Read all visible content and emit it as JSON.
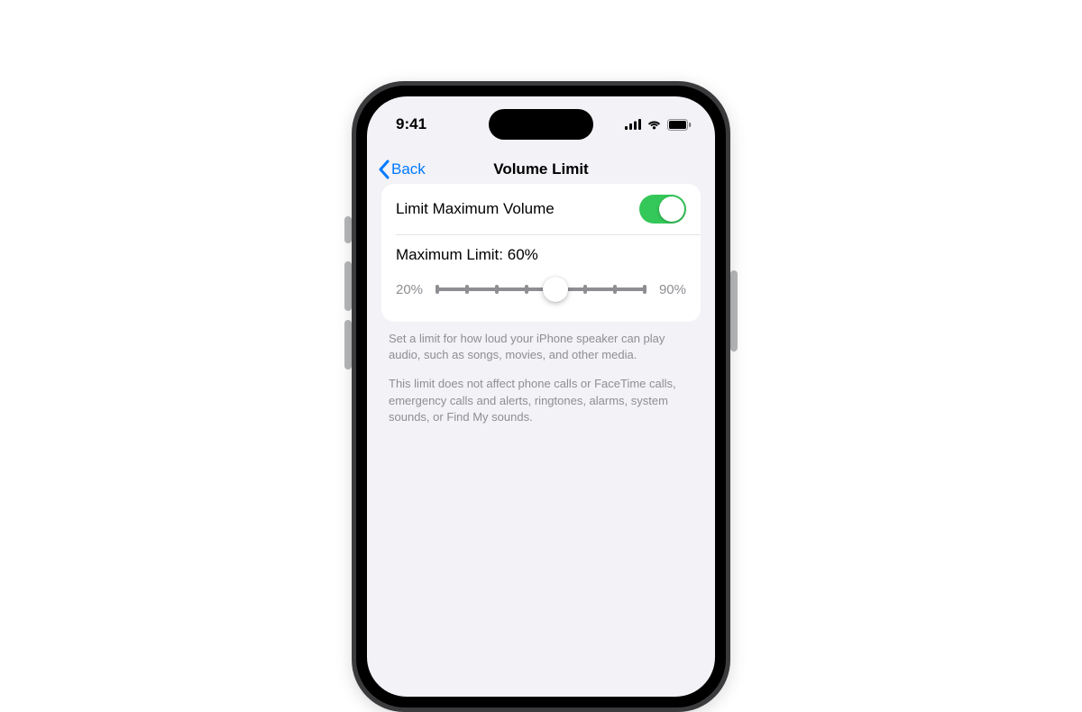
{
  "status": {
    "time": "9:41"
  },
  "nav": {
    "back_label": "Back",
    "title": "Volume Limit"
  },
  "settings": {
    "toggle_label": "Limit Maximum Volume",
    "toggle_on": true,
    "max_limit_label": "Maximum Limit:",
    "max_limit_value": "60%",
    "slider": {
      "min_label": "20%",
      "max_label": "90%",
      "min": 20,
      "max": 90,
      "step": 10,
      "value": 60
    }
  },
  "footer": {
    "p1": "Set a limit for how loud your iPhone speaker can play audio, such as songs, movies, and other media.",
    "p2": "This limit does not affect phone calls or FaceTime calls, emergency calls and alerts, ringtones, alarms, system sounds, or Find My sounds."
  }
}
